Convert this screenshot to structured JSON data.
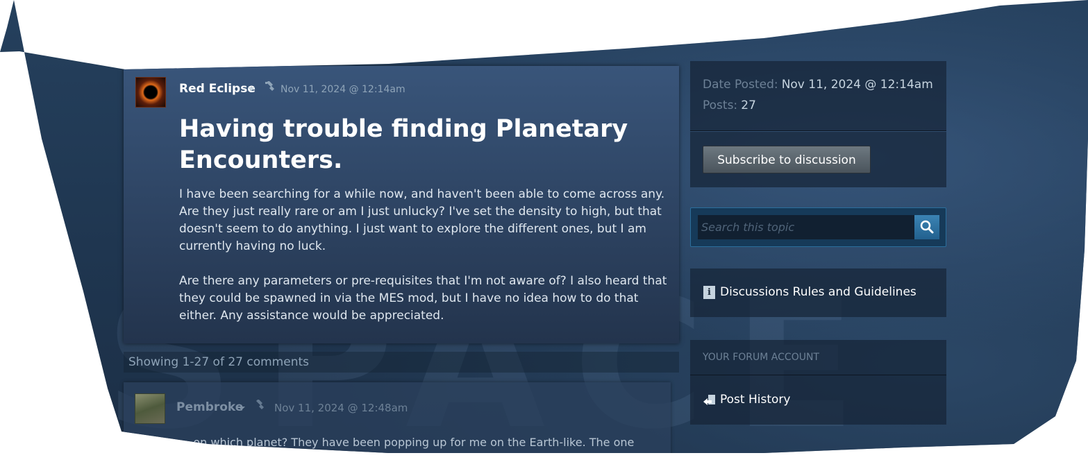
{
  "post": {
    "author": "Red Eclipse",
    "timestamp": "Nov 11, 2024 @ 12:14am",
    "title": "Having trouble finding Planetary Encounters.",
    "paragraphs": [
      "I have been searching for a while now, and haven't been able to come across any. Are they just really rare or am I just unlucky? I've set the density to high, but that doesn't seem to do anything. I just want to explore the different ones, but I am currently having no luck.",
      "Are there any parameters or pre-requisites that I'm not aware of? I also heard that they could be spawned in via the MES mod, but I have no idea how to do that either. Any assistance would be appreciated."
    ]
  },
  "comments_summary": "Showing 1-27 of 27 comments",
  "comment": {
    "author": "Pembroke",
    "timestamp": "Nov 11, 2024 @ 12:48am",
    "text": "... on which planet? They have been popping up for me on the Earth-like. The one"
  },
  "sidebar": {
    "date_posted_label": "Date Posted:",
    "date_posted_value": "Nov 11, 2024 @ 12:14am",
    "posts_label": "Posts:",
    "posts_value": "27",
    "subscribe_label": "Subscribe to discussion",
    "search_placeholder": "Search this topic",
    "rules_label": "Discussions Rules and Guidelines",
    "account_title": "YOUR FORUM ACCOUNT",
    "post_history_label": "Post History"
  },
  "background_text": "SPACE",
  "colors": {
    "accent_blue": "#2b6e9c",
    "panel_bg": "#23344d",
    "text_muted": "#6d8196"
  }
}
